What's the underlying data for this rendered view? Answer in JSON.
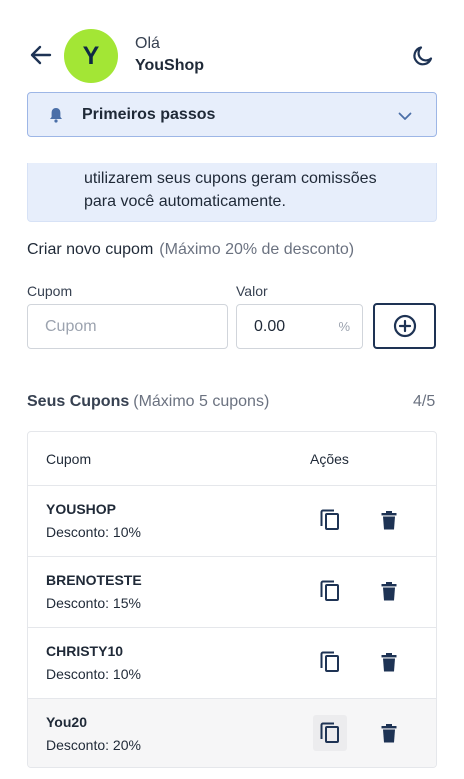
{
  "header": {
    "avatar_letter": "Y",
    "greeting": "Olá",
    "shop_name": "YouShop",
    "back_icon": "arrow-left-icon",
    "theme_icon": "moon-icon"
  },
  "accordion": {
    "title": "Primeiros passos",
    "icon": "bell-icon",
    "chevron": "chevron-down-icon",
    "body_text_line1": "utilizarem seus cupons geram comissões",
    "body_text_line2": "para você automaticamente."
  },
  "create": {
    "title": "Criar novo cupom",
    "subtitle": "(Máximo 20% de desconto)",
    "coupon_label": "Cupom",
    "coupon_placeholder": "Cupom",
    "value_label": "Valor",
    "value": "0.00",
    "value_suffix": "%",
    "add_icon": "plus-circle-icon"
  },
  "coupons": {
    "title": "Seus Cupons",
    "subtitle": "(Máximo 5 cupons)",
    "count": "4/5",
    "headers": {
      "coupon": "Cupom",
      "actions": "Ações"
    },
    "rows": [
      {
        "code": "YOUSHOP",
        "discount": "Desconto: 10%"
      },
      {
        "code": "BRENOTESTE",
        "discount": "Desconto: 15%"
      },
      {
        "code": "CHRISTY10",
        "discount": "Desconto: 10%"
      },
      {
        "code": "You20",
        "discount": "Desconto: 20%"
      }
    ]
  },
  "colors": {
    "accent_dark": "#1e3354",
    "avatar_bg": "#a3e635",
    "panel_bg": "#e7eefb",
    "panel_border": "#9db6e6"
  }
}
